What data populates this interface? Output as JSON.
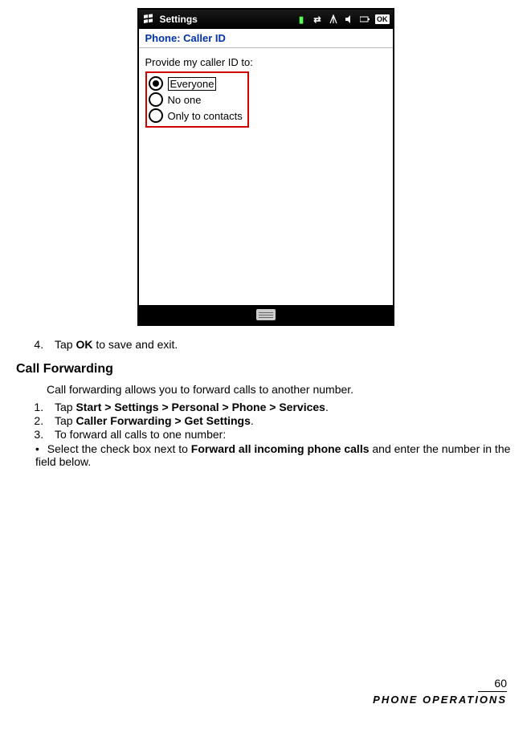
{
  "screenshot": {
    "titlebar": {
      "title": "Settings",
      "ok": "OK"
    },
    "subheader": "Phone: Caller ID",
    "prompt": "Provide my caller ID to:",
    "options": [
      {
        "label": "Everyone",
        "selected": true,
        "boxed": true
      },
      {
        "label": "No one",
        "selected": false,
        "boxed": false
      },
      {
        "label": "Only to contacts",
        "selected": false,
        "boxed": false
      }
    ]
  },
  "step4": {
    "num": "4.",
    "pre": "Tap ",
    "bold": "OK",
    "post": " to save and exit."
  },
  "heading": "Call Forwarding",
  "intro": "Call forwarding allows you to forward calls to another number.",
  "steps": [
    {
      "pre": "Tap ",
      "bold": "Start > Settings > Personal > Phone > Services",
      "post": "."
    },
    {
      "pre": "Tap ",
      "bold": "Caller Forwarding > Get Settings",
      "post": "."
    },
    {
      "pre": "To forward all calls to one number:",
      "bold": "",
      "post": ""
    }
  ],
  "bullet": {
    "pre": "Select the check box next to ",
    "bold": "Forward all incoming phone calls",
    "post": " and enter the number in the field below."
  },
  "footer": {
    "page": "60",
    "section": "Phone Operations"
  }
}
